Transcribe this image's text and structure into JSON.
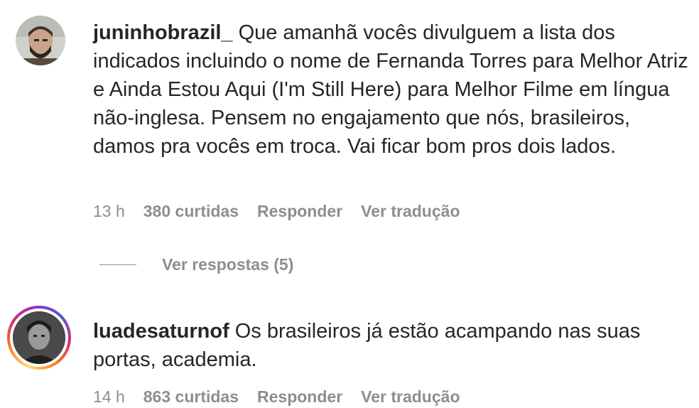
{
  "comments": [
    {
      "username": "juninhobrazil_",
      "text": "Que amanhã vocês divulguem a lista dos indicados incluindo o nome de Fernanda Torres para Melhor Atriz e Ainda Estou Aqui (I'm Still Here) para Melhor Filme em língua não-inglesa. Pensem no engajamento que nós, brasileiros, damos pra vocês em troca. Vai ficar bom pros dois lados.",
      "time": "13 h",
      "likes": "380 curtidas",
      "reply_label": "Responder",
      "translate_label": "Ver tradução",
      "view_replies_label": "Ver respostas (5)"
    },
    {
      "username": "luadesaturnof",
      "text": "Os brasileiros já estão acampando nas suas portas, academia.",
      "time": "14 h",
      "likes": "863 curtidas",
      "reply_label": "Responder",
      "translate_label": "Ver tradução"
    }
  ],
  "colors": {
    "text": "#262626",
    "secondary": "#8e8e8e",
    "story_ring": [
      "#feda75",
      "#fa7e1e",
      "#d62976",
      "#962fbf"
    ]
  }
}
